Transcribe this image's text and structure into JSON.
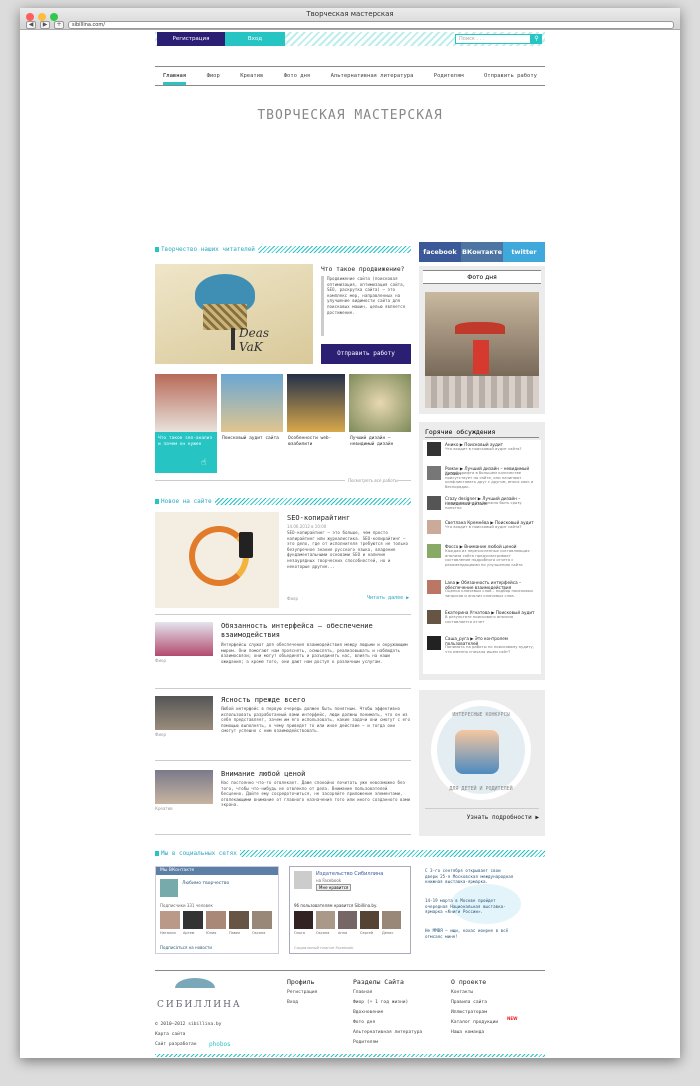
{
  "browser": {
    "title": "Творческая мастерская",
    "url": "sibillina.com/"
  },
  "topbar": {
    "register": "Регистрация",
    "login": "Вход",
    "search_placeholder": "Поиск . . ."
  },
  "menu": [
    "Главная",
    "Фиор",
    "Креатив",
    "Фото дня",
    "Альтернативная литература",
    "Родителям",
    "Отправить работу"
  ],
  "site_title": "ТВОРЧЕСКАЯ МАСТЕРСКАЯ",
  "readers": {
    "heading": "Творчество наших читателей",
    "feature_title": "Что такое продвижение?",
    "feature_text": "Продвижение сайта (поисковая оптимизация, оптимизация сайта, SEO, раскрутка сайта) — это комплекс мер, направленных на улучшение видимости сайта для поисковых машин, целью является достижение.",
    "submit_button": "Отправить работу",
    "thumbs": [
      "Что такое seo-анализ и зачем он нужен",
      "Поисковый аудит сайта",
      "Особенности web-юзабилити",
      "Лучший дизайн — невидимый дизайн"
    ],
    "view_all": "Посмотреть все работы"
  },
  "news": {
    "heading": "Новое на сайте",
    "lead_title": "SEO-копирайтинг",
    "lead_date": "14.06.2012 в 10:00",
    "lead_text": "SEO-копирайтинг – это больше, чем просто копирайтинг или журналистика. SEO-копирайтинг – это дело, где от исполнителя требуются не только безупречное знание русского языка, владение фундаментальными основами SEO и наличие незаурядных творческих способностей, но и некоторые другие...",
    "lead_author": "Фиор",
    "lead_more": "Читать далее ▶",
    "articles": [
      {
        "title": "Обязанность интерфейса — обеспечение взаимодействия",
        "text": "Интерфейсы служат для обеспечения взаимодействия между людьми и окружающим миром. Они помогают нам прояснять, осмыслять, реализовывать и наблюдать взаимосвязи; они могут объединять и разъединять нас, влиять на наши ожидания; а кроме того, они дают нам доступ к различным услугам.",
        "author": "Фиор"
      },
      {
        "title": "Ясность прежде всего",
        "text": "Любой интерфейс в первую очередь должен быть понятным. Чтобы эффективно использовать разработанный вами интерфейс, люди должны понимать, что он из себя представляет, зачем им его использовать, какие задачи они смогут с его помощью выполнять, к чему приведет то или иное действие – и тогда они смогут успешно с ним взаимодействовать.",
        "author": "Фиор"
      },
      {
        "title": "Внимание любой ценой",
        "text": "Нас постоянно что-то отвлекает. Даже спокойно почитать уже невозможно без того, чтобы что-нибудь не отвлекло от дела. Внимание пользователей бесценно. Дайте ему сосредоточиться, не засоряйте приложение элементами, отвлекающими внимание от главного назначения того или иного созданного вами экрана.",
        "author": "Креатив"
      }
    ]
  },
  "social_section": {
    "heading": "Мы в социальных сетях"
  },
  "vk_widget": {
    "header": "Мы ВКонтакте",
    "group": "Любимо творчество",
    "subscribers": "Подписчики 331 человек",
    "names": [
      "Наталия",
      "Артем",
      "Юлия",
      "Павел",
      "Оксана"
    ],
    "subscribe": "Подписаться на новости"
  },
  "fb_widget": {
    "name": "Издательство Сибиллина",
    "on": "на Facebook",
    "like": "Мне нравится",
    "count": "96 пользователям нравится Sibillina.by.",
    "names": [
      "Ольга",
      "Оксана",
      "Анна",
      "Сергей",
      "Денис"
    ],
    "plugin": "Социальный плагин Facebook"
  },
  "twitter_feed": [
    "С 3-го сентября открывает свои двери 25-я Московская международная книжная выставка-ярмарка.",
    "14-19 марта в Москве пройдет очередная Национальная выставка-ярмарка «Книги России».",
    "Не ММВЯ – ищи, кохас ионрне в всё отмсаяс мине!"
  ],
  "right": {
    "social": [
      "facebook",
      "ВКонтакте",
      "twitter"
    ],
    "photo_heading": "Фото дня",
    "hot_heading": "Горячие обсуждения",
    "discussions": [
      {
        "name": "Анико ▶ Поисковый аудит",
        "text": "Что входит в поисковый аудит сайта?"
      },
      {
        "name": "Роман ▶ Лучший дизайн – невидимый дизайн",
        "text": "Когда шрифта в большем количестве присутствует на сайте, они начинают конфликтовать друг с другом, внося хаос и беспорядок."
      },
      {
        "name": "Crazy designer ▶ Лучший дизайн – невидимый дизайн",
        "text": "Назначение сайта должно быть сразу понятно"
      },
      {
        "name": "Светлана Кремнёва ▶ Поисковый аудит",
        "text": "Что входит в поисковый аудит сайта?"
      },
      {
        "name": "Фоссо ▶ Внимание любой ценой",
        "text": "Каждая из перечисленных составляющих анализа сайта предусматривает составление подробного отчета с рекомендациями по улучшению сайта"
      },
      {
        "name": "Lana ▶ Обязанность интерфейса – обеспечение взаимодействия",
        "text": "Оценка ключевых слов – подбор поисковых запросов и анализ ключевых слов."
      },
      {
        "name": "Екатерина Угнатова ▶ Поисковый аудит",
        "text": "В результате поискового анализа составляется отчет"
      },
      {
        "name": "Саша_руга ▶ Это контролем пользователей",
        "text": "Понимать на работы по поисковому аудиту, что именно сначала ищем сайт?"
      }
    ],
    "contest_heading": "ИНТЕРЕСНЫЕ КОНКУРСЫ",
    "contest_sub": "ДЛЯ ДЕТЕЙ И РОДИТЕЛЕЙ",
    "contest_more": "Узнать подробности ▶"
  },
  "footer": {
    "logo": "СИБИЛЛИНА",
    "copyright": "© 2010–2012 sibillina.by",
    "sitemap": "Карта сайта",
    "dev": "Сайт разработан",
    "dev_brand": "phobos",
    "profile_h": "Профиль",
    "profile": [
      "Регистрация",
      "Вход"
    ],
    "sections_h": "Разделы Сайта",
    "sections": [
      "Главная",
      "Фиор (+ 1 год жизни)",
      "Вдохновение",
      "Фото дня",
      "Альтернативная литература",
      "Родителям"
    ],
    "about_h": "О проекте",
    "about": [
      "Контакты",
      "Правила сайта",
      "Иллюстраторам",
      "Каталог продукции",
      "Наша команда"
    ],
    "new_badge": "NEW"
  }
}
